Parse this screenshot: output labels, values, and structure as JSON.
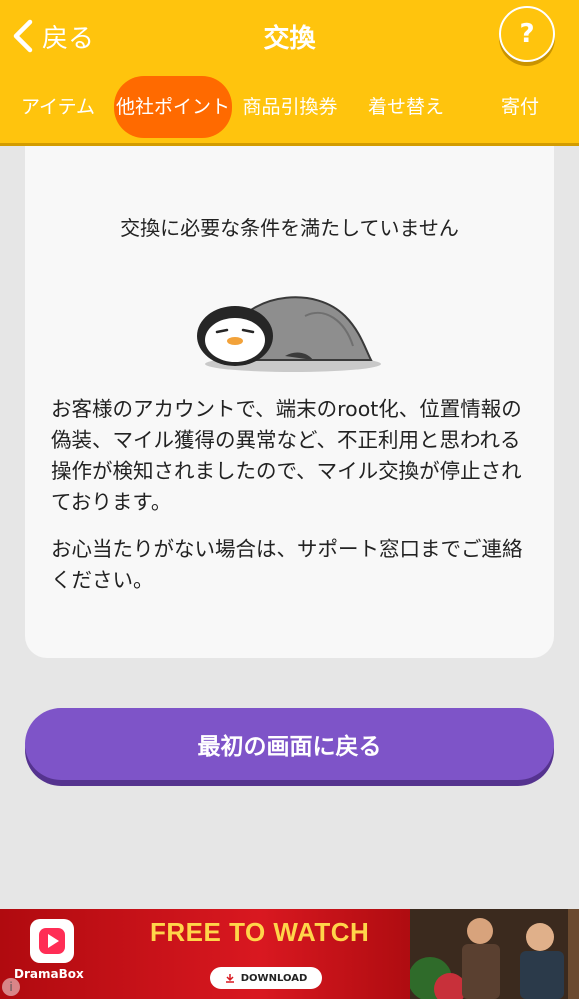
{
  "header": {
    "back_label": "戻る",
    "title": "交換",
    "help_label": "?"
  },
  "tabs": [
    {
      "label": "アイテム",
      "active": false
    },
    {
      "label": "他社ポイント",
      "active": true
    },
    {
      "label": "商品引換券",
      "active": false
    },
    {
      "label": "着せ替え",
      "active": false
    },
    {
      "label": "寄付",
      "active": false
    }
  ],
  "card": {
    "title": "交換に必要な条件を満たしていません",
    "paragraph1": "お客様のアカウントで、端末のroot化、位置情報の偽装、マイル獲得の異常など、不正利用と思われる操作が検知されましたので、マイル交換が停止されております。",
    "paragraph2": "お心当たりがない場合は、サポート窓口までご連絡ください。"
  },
  "primary_button": {
    "label": "最初の画面に戻る"
  },
  "ad": {
    "brand": "DramaBox",
    "headline": "FREE TO WATCH",
    "download_label": "DOWNLOAD"
  },
  "colors": {
    "header": "#ffc40d",
    "active_tab": "#ff6a00",
    "button": "#7e54c8",
    "background": "#e6e6e6"
  }
}
